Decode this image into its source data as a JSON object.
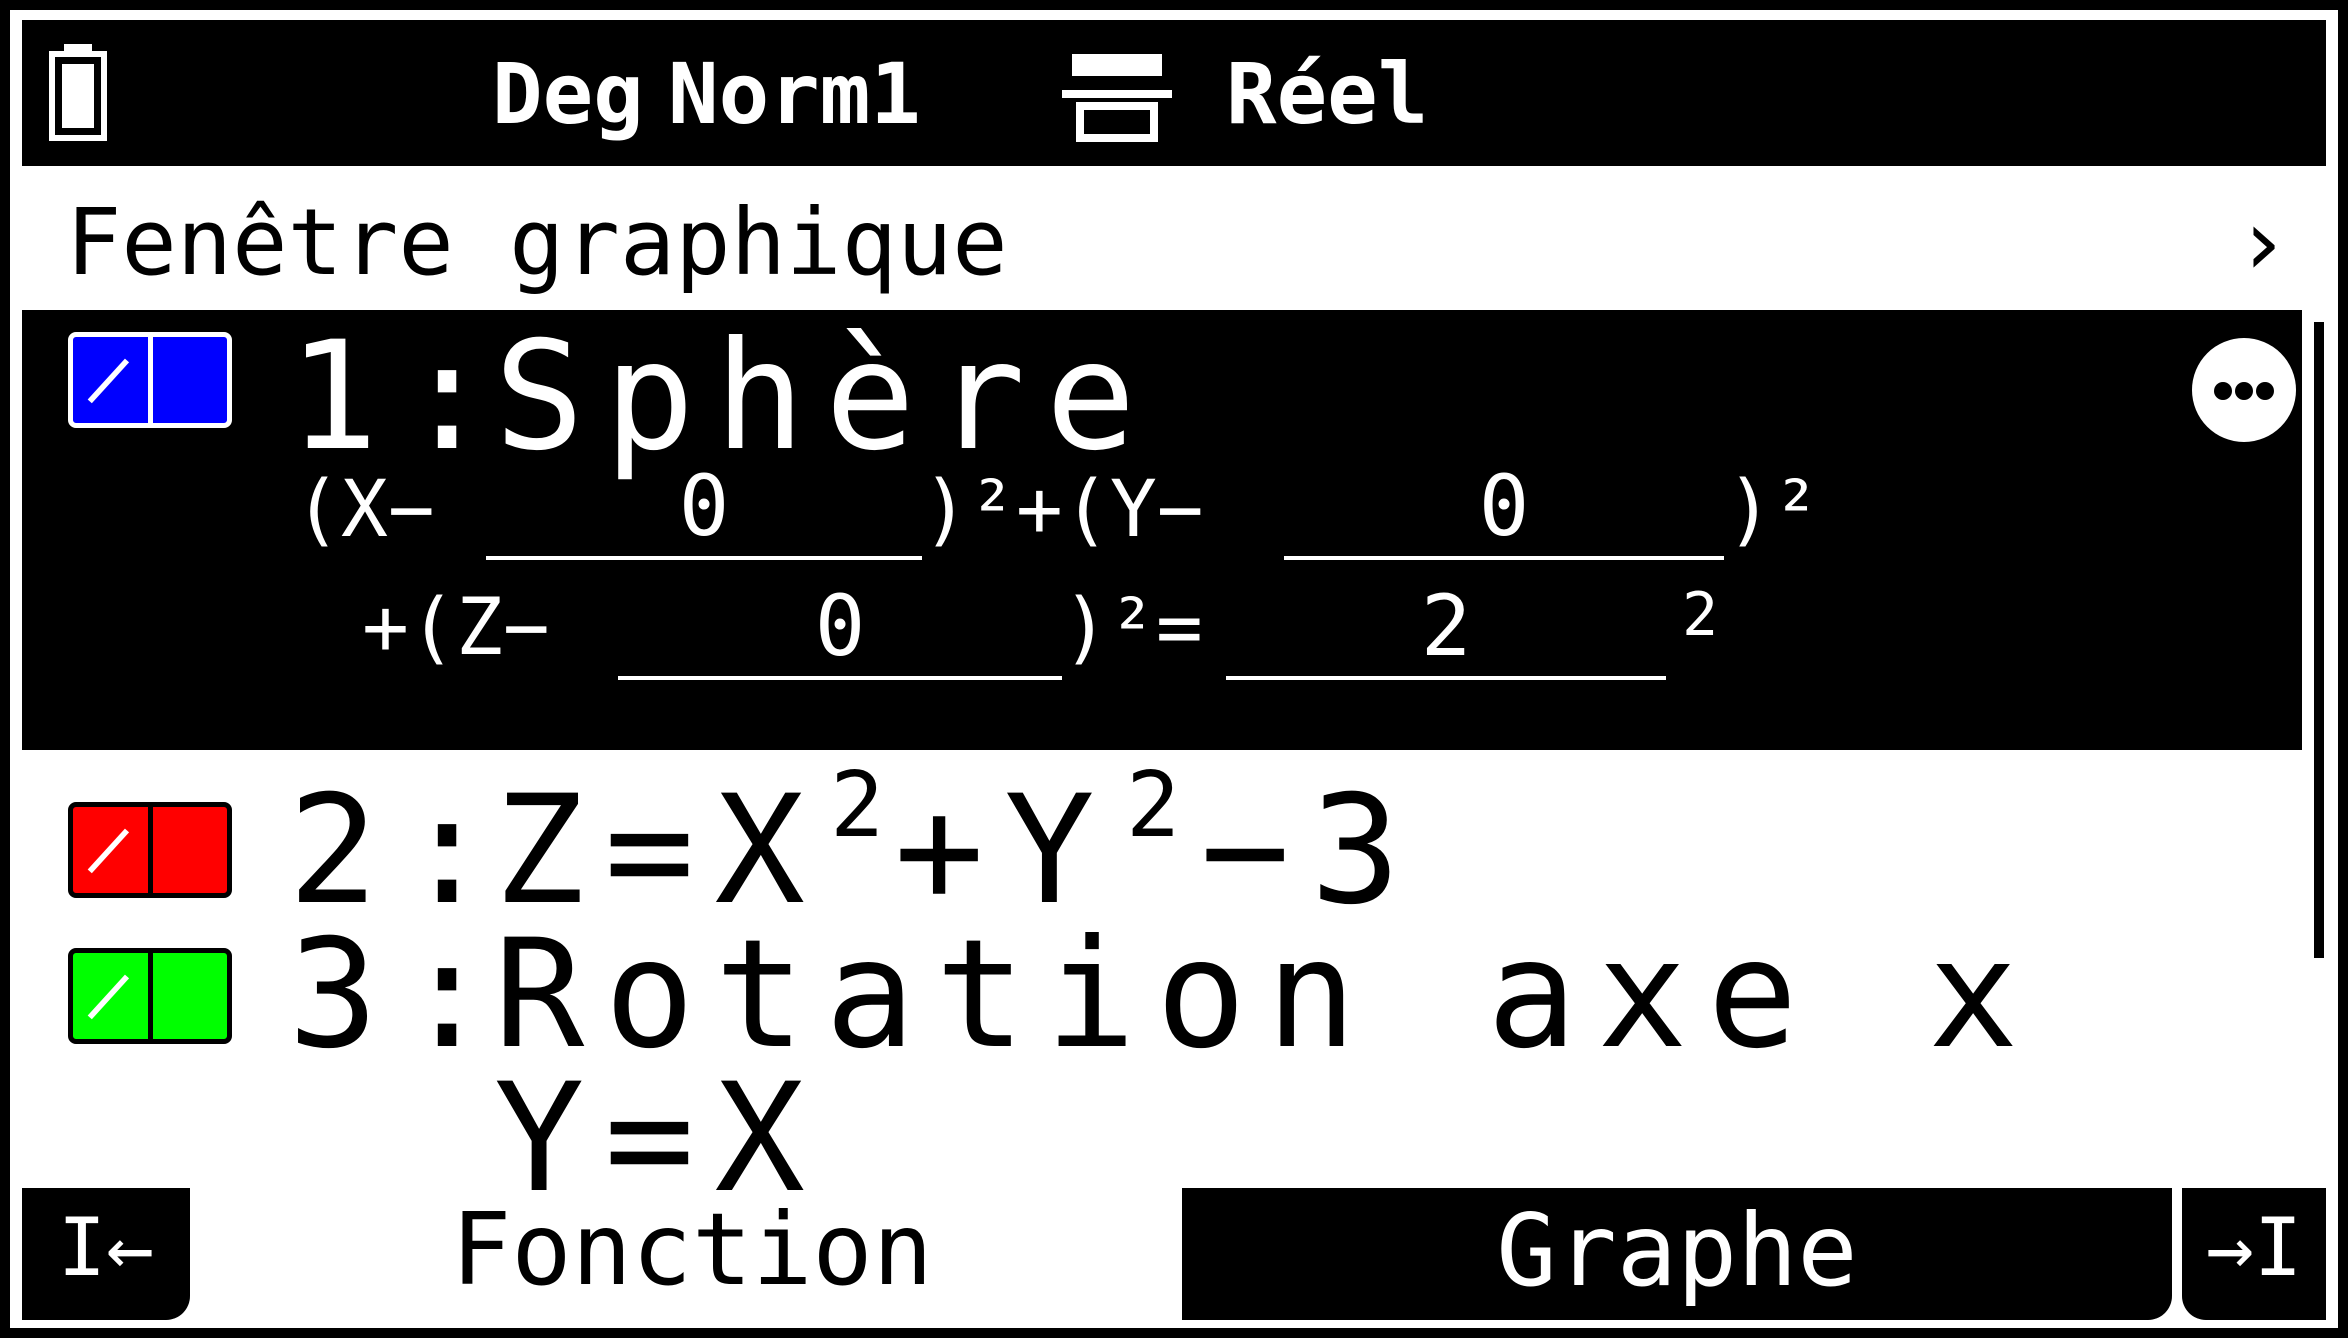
{
  "statusbar": {
    "angle_mode": "Deg",
    "display_format": "Norm1",
    "complex_mode": "Réel"
  },
  "header": {
    "title": "Fenêtre graphique",
    "chevron": "›"
  },
  "functions": [
    {
      "index": "1",
      "separator": ":",
      "name": "Sphère",
      "color": "#0000ff",
      "selected": true,
      "x_term_prefix": "(X−",
      "x_center": "0",
      "y_term_prefix": ")²+(Y−",
      "y_center": "0",
      "y_term_suffix": ")²",
      "z_term_prefix": "+(Z−",
      "z_center": "0",
      "z_term_suffix": ")²=",
      "radius": "2",
      "radius_exponent": "2"
    },
    {
      "index": "2",
      "separator": ":",
      "lhs": "Z=X",
      "exp1": "2",
      "mid": "+Y",
      "exp2": "2",
      "rhs": "−3",
      "color": "#ff0000"
    },
    {
      "index": "3",
      "separator": ":",
      "name": "Rotation axe x",
      "equation": "Y=X",
      "color": "#00ff00"
    }
  ],
  "tabs": {
    "first": "I←",
    "function": "Fonction",
    "graph": "Graphe",
    "last": "→I"
  },
  "icons": {
    "battery": "battery-icon",
    "display": "display-mode-icon",
    "more": "more-options-icon"
  }
}
